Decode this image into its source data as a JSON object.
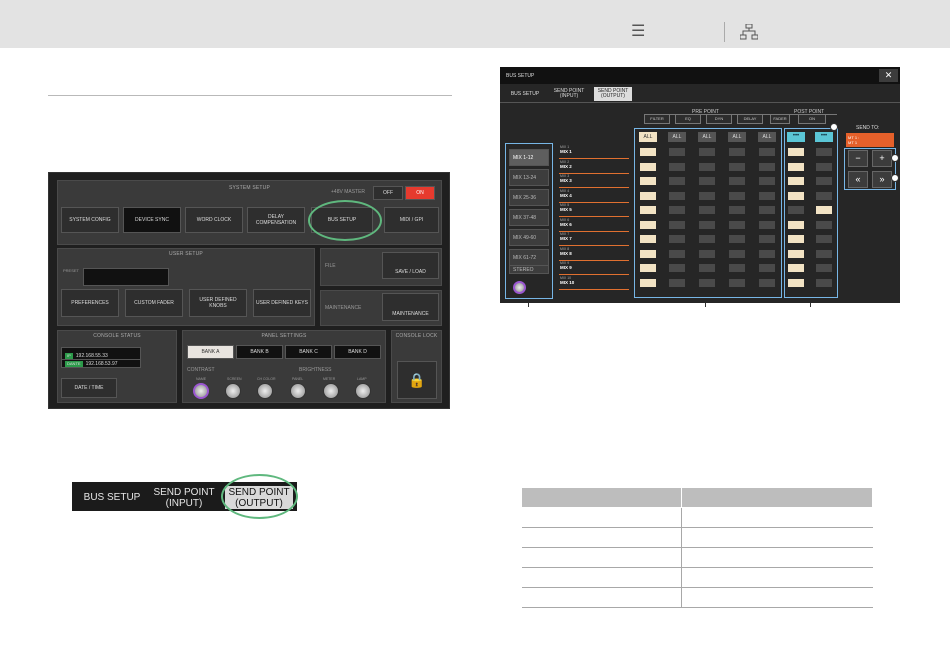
{
  "toolbar": {
    "toc_icon": "toc-icon",
    "sitemap_icon": "sitemap-icon"
  },
  "system_setup_screen": {
    "system_setup_title": "SYSTEM SETUP",
    "plus48v_label": "+48V MASTER",
    "off_label": "OFF",
    "on_label": "ON",
    "buttons": [
      "SYSTEM CONFIG",
      "DEVICE SYNC",
      "WORD CLOCK",
      "DELAY COMPENSATION",
      "BUS SETUP",
      "MIDI / GPI"
    ],
    "user_setup_title": "USER SETUP",
    "preset_label": "PRESET",
    "file_label": "FILE",
    "save_load_label": "SAVE / LOAD",
    "user_buttons": [
      "PREFERENCES",
      "CUSTOM FADER",
      "USER DEFINED KNOBS",
      "USER DEFINED KEYS"
    ],
    "maintenance_label": "MAINTENANCE",
    "maintenance_button": "MAINTENANCE",
    "console_status_title": "CONSOLE STATUS",
    "ip1_tag": "IP",
    "ip1": "192.168.55.33",
    "ip2_tag": "DANTE",
    "ip2": "192.168.53.97",
    "date_time_label": "DATE / TIME",
    "panel_settings_title": "PANEL SETTINGS",
    "banks": [
      "BANK A",
      "BANK B",
      "BANK C",
      "BANK D"
    ],
    "contrast_label": "CONTRAST",
    "brightness_label": "BRIGHTNESS",
    "knob_labels": [
      "NAME",
      "SCREEN",
      "CH COLOR",
      "PANEL",
      "METER",
      "LAMP"
    ],
    "console_lock_title": "CONSOLE LOCK"
  },
  "tab_strip": {
    "tab1": "BUS SETUP",
    "tab2_line1": "SEND POINT",
    "tab2_line2": "(INPUT)",
    "tab3_line1": "SEND POINT",
    "tab3_line2": "(OUTPUT)"
  },
  "bus_setup_screen": {
    "window_title": "BUS SETUP",
    "close_label": "✕",
    "tabs": [
      {
        "line1": "BUS SETUP",
        "line2": ""
      },
      {
        "line1": "SEND POINT",
        "line2": "(INPUT)"
      },
      {
        "line1": "SEND POINT",
        "line2": "(OUTPUT)"
      }
    ],
    "pre_point_label": "PRE POINT",
    "post_point_label": "POST POINT",
    "filter_labels": [
      "FILTER",
      "EQ",
      "DYN",
      "DELAY",
      "FADER",
      "ON"
    ],
    "all_label": "ALL",
    "more_label": "•••",
    "mix_selectors": [
      "MIX 1-12",
      "MIX 13-24",
      "MIX 25-36",
      "MIX 37-48",
      "MIX 49-60",
      "MIX 61-72",
      "STEREO"
    ],
    "mix_rows": [
      {
        "num": "MIX 1",
        "name": "MIX 1"
      },
      {
        "num": "MIX 2",
        "name": "MIX 2"
      },
      {
        "num": "MIX 3",
        "name": "MIX 3"
      },
      {
        "num": "MIX 4",
        "name": "MIX 4"
      },
      {
        "num": "MIX 5",
        "name": "MIX 5"
      },
      {
        "num": "MIX 6",
        "name": "MIX 6"
      },
      {
        "num": "MIX 7",
        "name": "MIX 7"
      },
      {
        "num": "MIX 8",
        "name": "MIX 8"
      },
      {
        "num": "MIX 9",
        "name": "MIX 9"
      },
      {
        "num": "MIX 10",
        "name": "MIX 10"
      }
    ],
    "send_to_label": "SEND TO:",
    "send_to_value_line1": "MT 1 :",
    "send_to_value_line2": "MT 1",
    "minus_label": "−",
    "plus_label": "+",
    "prev_label": "«",
    "next_label": "»"
  }
}
